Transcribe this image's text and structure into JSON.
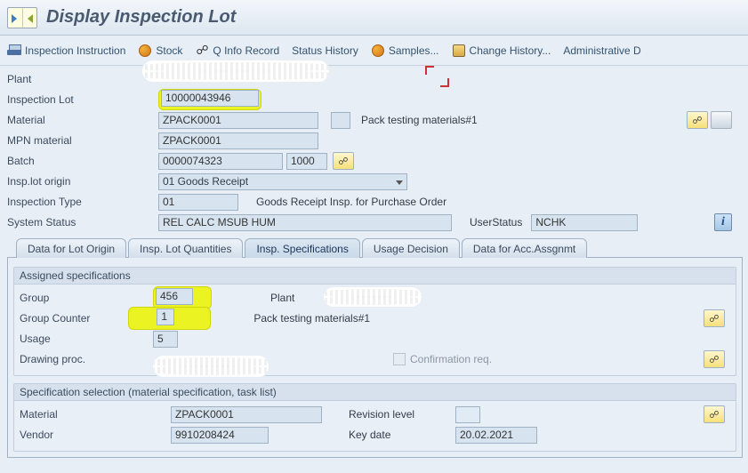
{
  "title": "Display Inspection Lot",
  "toolbar": {
    "instruction": "Inspection Instruction",
    "stock": "Stock",
    "qinfo": "Q Info Record",
    "status_history": "Status History",
    "samples": "Samples...",
    "change_history": "Change History...",
    "admin": "Administrative D"
  },
  "header": {
    "plant_label": "Plant",
    "inspection_lot_label": "Inspection Lot",
    "inspection_lot": "10000043946",
    "material_label": "Material",
    "material": "ZPACK0001",
    "material_text": "Pack testing materials#1",
    "mpn_label": "MPN material",
    "mpn": "ZPACK0001",
    "batch_label": "Batch",
    "batch": "0000074323",
    "batch_sub": "1000",
    "origin_label": "Insp.lot origin",
    "origin": "01 Goods Receipt",
    "inspection_type_label": "Inspection Type",
    "inspection_type": "01",
    "inspection_type_text": "Goods Receipt Insp. for Purchase Order",
    "system_status_label": "System Status",
    "system_status": "REL  CALC MSUB HUM",
    "user_status_label": "UserStatus",
    "user_status": "NCHK"
  },
  "tabs": {
    "t1": "Data for Lot Origin",
    "t2": "Insp. Lot Quantities",
    "t3": "Insp. Specifications",
    "t4": "Usage Decision",
    "t5": "Data for Acc.Assgnmt"
  },
  "assigned": {
    "legend": "Assigned specifications",
    "group_label": "Group",
    "group": "456",
    "plant_label": "Plant",
    "group_counter_label": "Group Counter",
    "group_counter": "1",
    "group_counter_text": "Pack testing materials#1",
    "usage_label": "Usage",
    "usage": "5",
    "drawing_label": "Drawing proc.",
    "confirm_label": "Confirmation req."
  },
  "selection": {
    "legend": "Specification selection (material specification, task list)",
    "material_label": "Material",
    "material": "ZPACK0001",
    "revision_label": "Revision level",
    "vendor_label": "Vendor",
    "vendor": "9910208424",
    "keydate_label": "Key date",
    "keydate": "20.02.2021"
  }
}
